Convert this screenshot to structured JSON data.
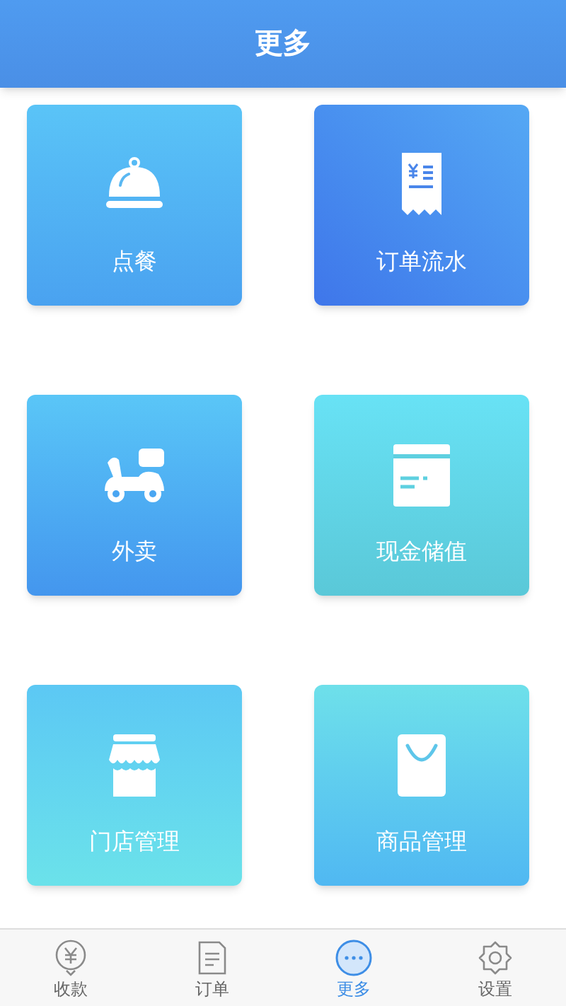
{
  "header": {
    "title": "更多"
  },
  "tiles": [
    {
      "label": "点餐",
      "kind": "dining"
    },
    {
      "label": "订单流水",
      "kind": "receipt"
    },
    {
      "label": "外卖",
      "kind": "delivery"
    },
    {
      "label": "现金储值",
      "kind": "wallet"
    },
    {
      "label": "门店管理",
      "kind": "store"
    },
    {
      "label": "商品管理",
      "kind": "bag"
    }
  ],
  "tab_bar": [
    {
      "label": "收款",
      "kind": "payment",
      "selected": false
    },
    {
      "label": "订单",
      "kind": "orders",
      "selected": false
    },
    {
      "label": "更多",
      "kind": "more",
      "selected": true
    },
    {
      "label": "设置",
      "kind": "settings",
      "selected": false
    }
  ]
}
